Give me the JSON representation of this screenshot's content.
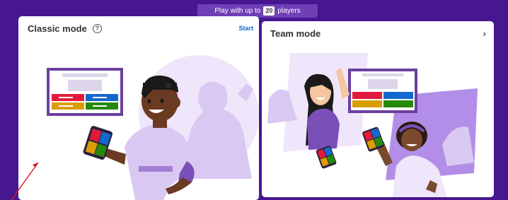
{
  "banner": {
    "prefix": "Play with up to",
    "count": "20",
    "suffix": "players"
  },
  "classic_card": {
    "title": "Classic mode",
    "action": "Start",
    "help_icon": "question-circle-icon"
  },
  "team_card": {
    "title": "Team mode",
    "chevron_icon": "chevron-right-icon"
  },
  "colors": {
    "background": "#46178f",
    "banner": "#6f3fb5",
    "accent_link": "#1368ce",
    "answer_red": "#e21b3c",
    "answer_blue": "#1368ce",
    "answer_yellow": "#d89e00",
    "answer_green": "#26890c",
    "illustration_purple": "#d9c9f2"
  }
}
